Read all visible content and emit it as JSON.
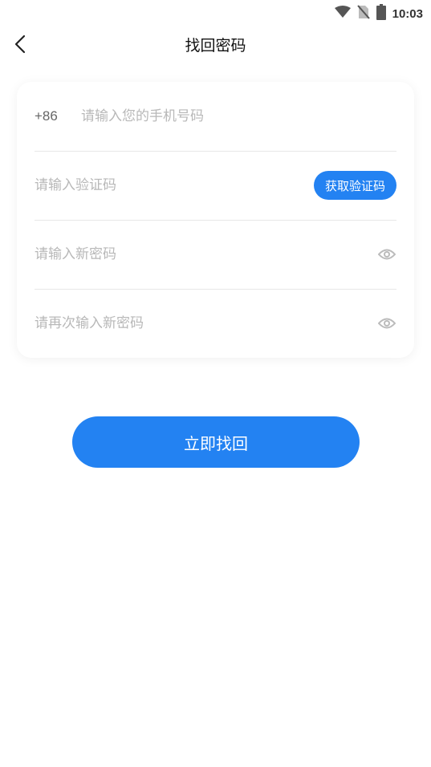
{
  "status_bar": {
    "time": "10:03",
    "icons": [
      "wifi-icon",
      "no-sim-icon",
      "battery-icon"
    ]
  },
  "nav": {
    "title": "找回密码",
    "back_icon": "chevron-left-icon"
  },
  "form": {
    "phone": {
      "country_code": "+86",
      "placeholder": "请输入您的手机号码",
      "value": ""
    },
    "code": {
      "placeholder": "请输入验证码",
      "value": "",
      "button_label": "获取验证码"
    },
    "new_password": {
      "placeholder": "请输入新密码",
      "value": "",
      "toggle_icon": "eye-icon"
    },
    "confirm_password": {
      "placeholder": "请再次输入新密码",
      "value": "",
      "toggle_icon": "eye-icon"
    }
  },
  "submit": {
    "label": "立即找回"
  },
  "colors": {
    "accent": "#2382f2",
    "placeholder": "#b8b8b8",
    "divider": "#e8e8e8"
  }
}
